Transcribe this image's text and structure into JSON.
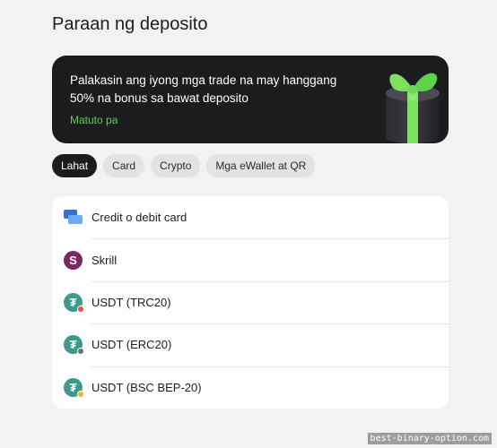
{
  "page": {
    "title": "Paraan ng deposito"
  },
  "promo": {
    "text": "Palakasin ang iyong mga trade na may hanggang 50% na bonus sa bawat deposito",
    "link_label": "Matuto pa",
    "link_color": "#5fd14a",
    "image_icon": "gift-box-icon"
  },
  "tabs": [
    {
      "label": "Lahat",
      "active": true
    },
    {
      "label": "Card",
      "active": false
    },
    {
      "label": "Crypto",
      "active": false
    },
    {
      "label": "Mga eWallet at QR",
      "active": false
    }
  ],
  "methods": [
    {
      "label": "Credit o debit card",
      "icon": "credit-card-icon"
    },
    {
      "label": "Skrill",
      "icon": "skrill-icon"
    },
    {
      "label": "USDT (TRC20)",
      "icon": "tether-icon",
      "network_color": "#e5533d"
    },
    {
      "label": "USDT (ERC20)",
      "icon": "tether-icon",
      "network_color": "#6b6f80"
    },
    {
      "label": "USDT (BSC BEP-20)",
      "icon": "tether-icon",
      "network_color": "#e9b826"
    }
  ],
  "watermark": "best-binary-option.com"
}
